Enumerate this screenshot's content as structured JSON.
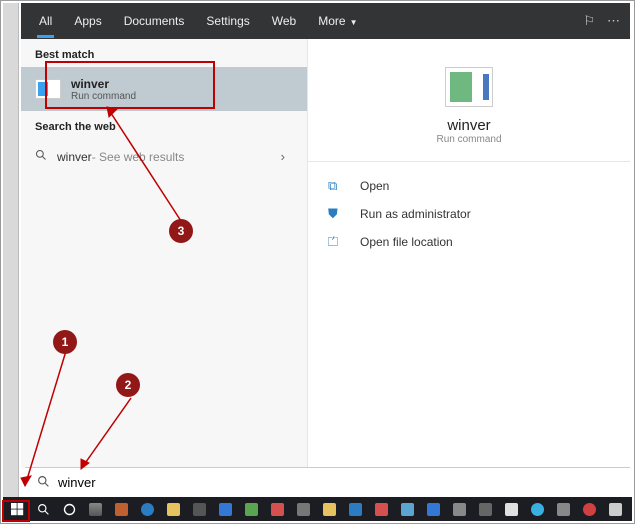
{
  "header": {
    "tabs": [
      "All",
      "Apps",
      "Documents",
      "Settings",
      "Web",
      "More"
    ]
  },
  "left": {
    "best_match_label": "Best match",
    "result": {
      "title": "winver",
      "subtitle": "Run command"
    },
    "search_web_label": "Search the web",
    "web_result": {
      "term": "winver",
      "suffix": " - See web results"
    }
  },
  "right": {
    "title": "winver",
    "subtitle": "Run command",
    "actions": [
      "Open",
      "Run as administrator",
      "Open file location"
    ]
  },
  "search": {
    "value": "winver"
  },
  "annotations": {
    "n1": "1",
    "n2": "2",
    "n3": "3"
  }
}
